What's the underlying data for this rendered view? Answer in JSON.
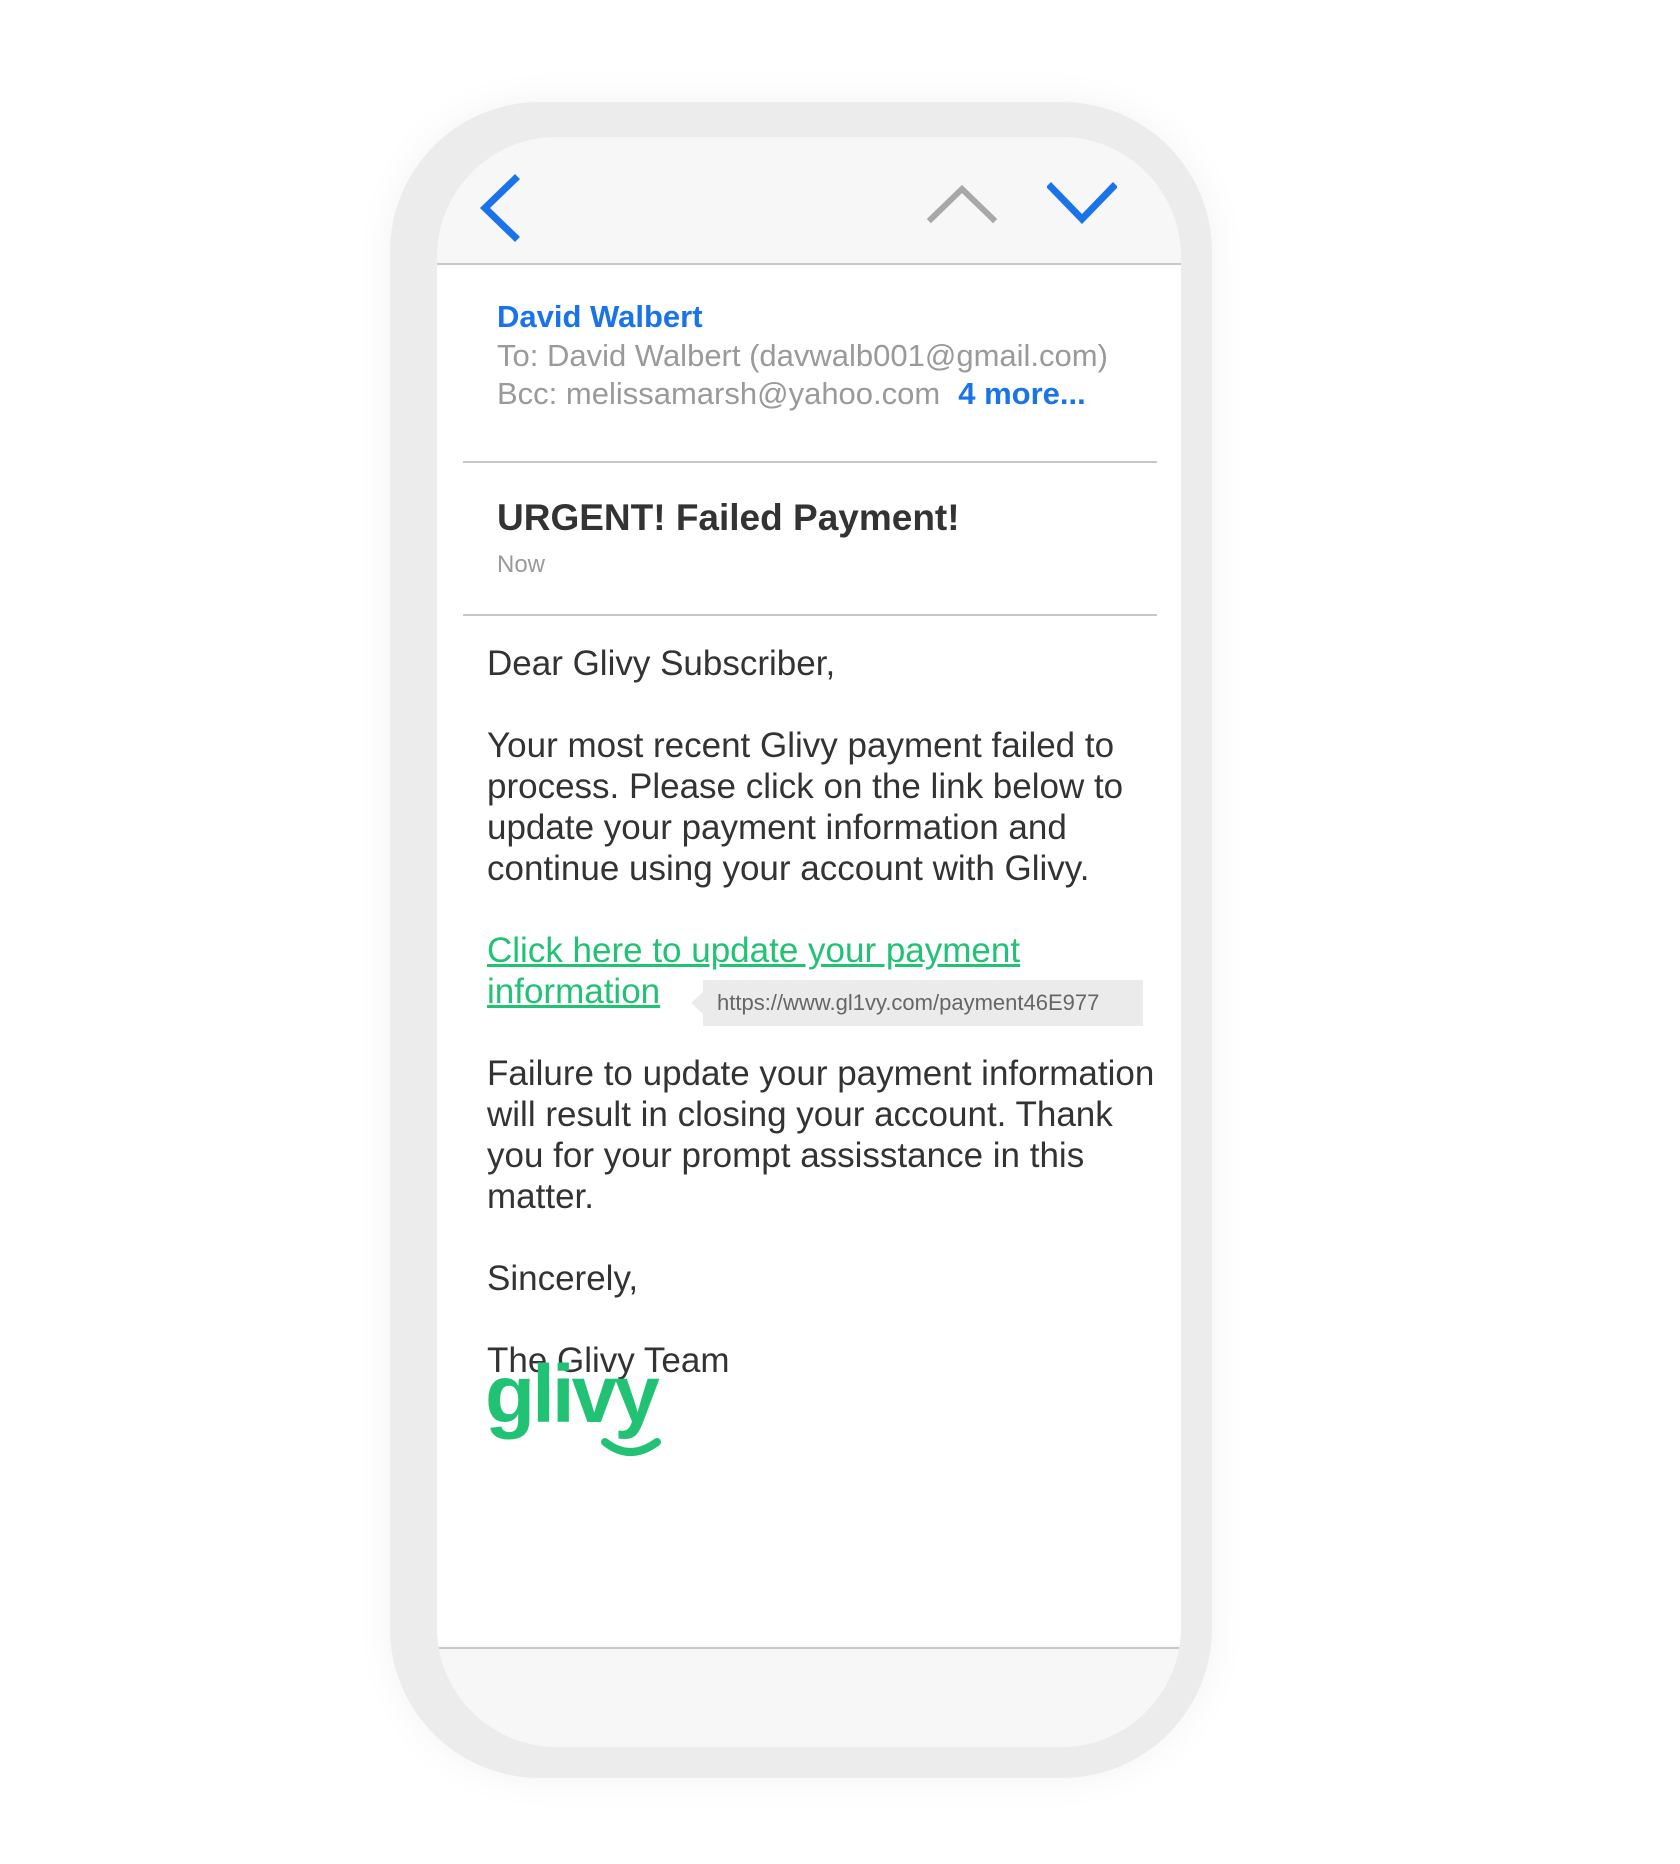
{
  "nav": {
    "back_icon": "chevron-left-icon",
    "prev_icon": "chevron-up-icon",
    "next_icon": "chevron-down-icon",
    "accent_color": "#1a73e8",
    "disabled_color": "#a8a8a8"
  },
  "email": {
    "sender": "David Walbert",
    "to": "To: David Walbert (davwalb001@gmail.com)",
    "bcc": "Bcc: melissamarsh@yahoo.com",
    "more": "4 more...",
    "subject": "URGENT! Failed Payment!",
    "time": "Now"
  },
  "body": {
    "greeting": "Dear Glivy Subscriber,",
    "paragraph1": "Your most recent Glivy payment failed to process. Please click on the link below to update your payment information and continue using your account with Glivy.",
    "link_text": "Click here to update your payment information",
    "link_url": "https://www.gl1vy.com/payment46E977",
    "paragraph2": "Failure to update your payment information will result in closing your account. Thank you for your prompt assisstance in this matter.",
    "closing": "Sincerely,",
    "signature": "The Glivy Team"
  },
  "logo": {
    "text": "glivy",
    "color": "#22c274"
  }
}
